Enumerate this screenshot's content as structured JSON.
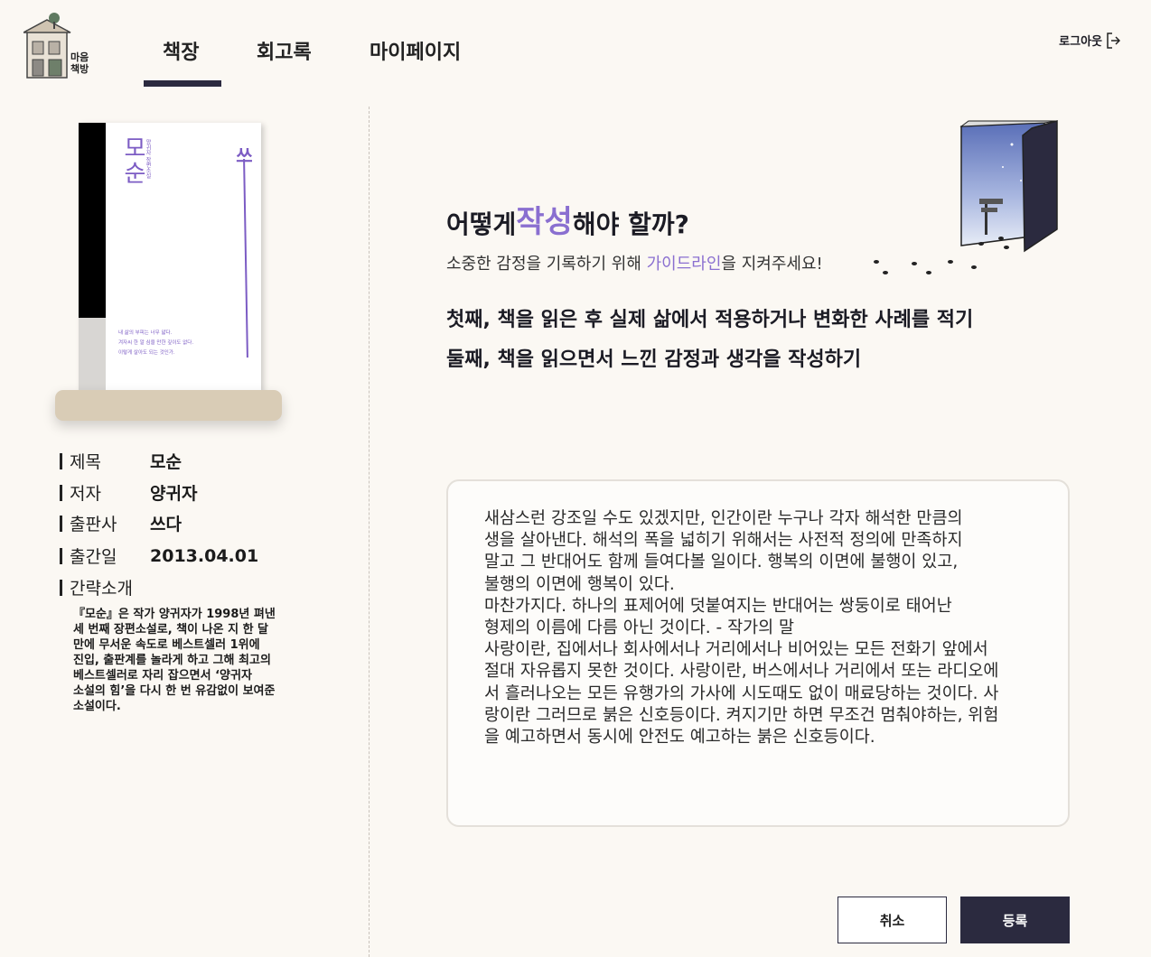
{
  "header": {
    "logo_text": "마음\n책방",
    "nav": [
      {
        "label": "책장",
        "active": true
      },
      {
        "label": "회고록",
        "active": false
      },
      {
        "label": "마이페이지",
        "active": false
      }
    ],
    "logout_label": "로그아웃"
  },
  "book": {
    "cover_title": "모순",
    "cover_subtitle": "양귀자 장편소설",
    "cover_publisher": "쓰",
    "cover_quote": "내 삶의 부피는 너무 얇다.\n겨자씨 한 알 심을 만한 깊이도 없다.\n이렇게 살아도 되는 것인가.",
    "fields": [
      {
        "label": "제목",
        "value": "모순"
      },
      {
        "label": "저자",
        "value": "양귀자"
      },
      {
        "label": "출판사",
        "value": "쓰다"
      },
      {
        "label": "출간일",
        "value": "2013.04.01"
      },
      {
        "label": "간략소개",
        "value": ""
      }
    ],
    "summary": "『모순』은 작가 양귀자가 1998년 펴낸 세 번째 장편소설로, 책이 나온 지 한 달 만에 무서운 속도로 베스트셀러 1위에 진입, 출판계를 놀라게 하고 그해 최고의 베스트셀러로 자리 잡으면서 ‘양귀자 소설의 힘’을 다시 한 번 유감없이 보여준 소설이다."
  },
  "guide": {
    "title_pre": "어떻게 ",
    "title_accent": "작성",
    "title_post": "해야 할까?",
    "sub_pre": "소중한 감정을 기록하기 위해 ",
    "sub_link": "가이드라인",
    "sub_post": "을 지켜주세요!",
    "rules": [
      "첫째, 책을 읽은 후 실제 삶에서 적용하거나 변화한 사례를 적기",
      "둘째, 책을 읽으면서 느낀 감정과 생각을 작성하기"
    ]
  },
  "editor": {
    "content": "새삼스런 강조일 수도 있겠지만, 인간이란 누구나 각자 해석한 만큼의\n생을 살아낸다. 해석의 폭을 넓히기 위해서는 사전적 정의에 만족하지\n말고 그 반대어도 함께 들여다볼 일이다. 행복의 이면에 불행이 있고,\n불행의 이면에 행복이 있다.\n마찬가지다. 하나의 표제어에 덧붙여지는 반대어는 쌍둥이로 태어난\n형제의 이름에 다름 아닌 것이다.  - 작가의 말\n사랑이란, 집에서나 회사에서나 거리에서나 비어있는 모든 전화기 앞에서\n절대 자유롭지 못한 것이다. 사랑이란, 버스에서나 거리에서 또는 라디오에\n서 흘러나오는 모든 유행가의 가사에 시도때도 없이 매료당하는 것이다. 사\n랑이란 그러므로 붉은 신호등이다. 켜지기만 하면 무조건 멈춰야하는, 위험\n을 예고하면서 동시에 안전도 예고하는 붉은 신호등이다."
  },
  "actions": {
    "cancel_label": "취소",
    "submit_label": "등록"
  },
  "colors": {
    "accent": "#8a6fd0",
    "dark": "#2b2a3f",
    "background": "#fbf8f3"
  }
}
